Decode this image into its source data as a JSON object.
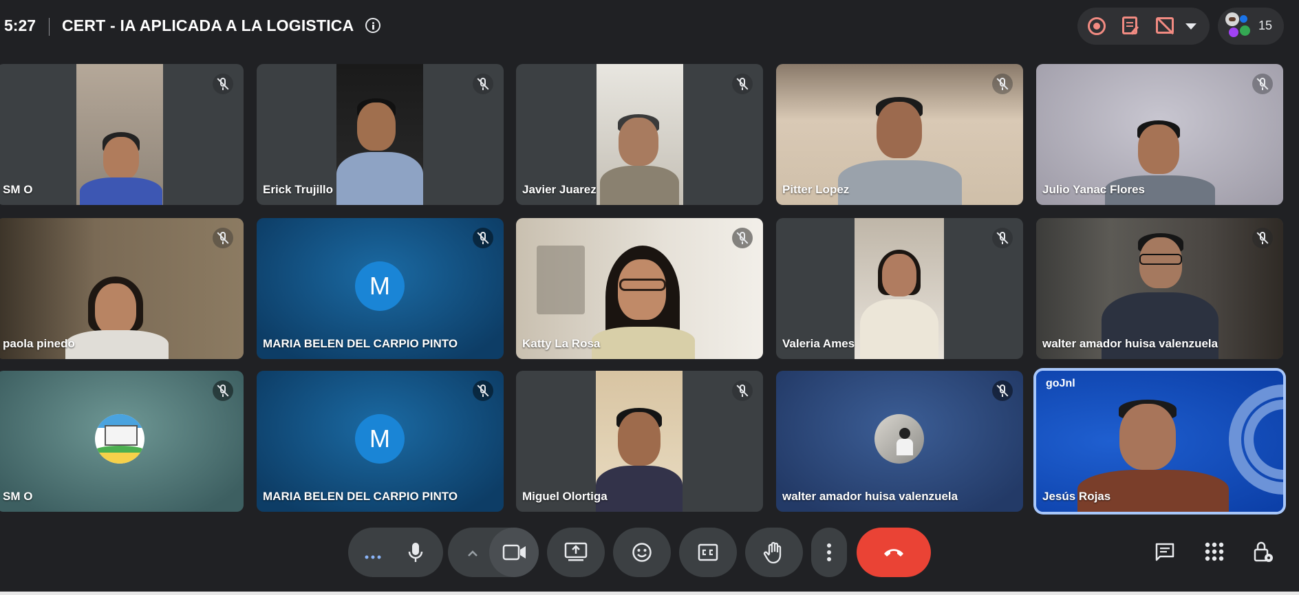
{
  "header": {
    "time": "5:27",
    "meeting_title": "CERT - IA APLICADA A LA LOGISTICA",
    "people_count": "15"
  },
  "tiles": [
    {
      "name": "SM O"
    },
    {
      "name": "Erick Trujillo"
    },
    {
      "name": "Javier Juarez"
    },
    {
      "name": "Pitter Lopez"
    },
    {
      "name": "Julio Yanac Flores"
    },
    {
      "name": "paola pinedo"
    },
    {
      "name": "MARIA BELEN DEL CARPIO PINTO",
      "initial": "M"
    },
    {
      "name": "Katty La Rosa"
    },
    {
      "name": "Valeria Ames"
    },
    {
      "name": "walter amador huisa valenzuela"
    },
    {
      "name": "SM O"
    },
    {
      "name": "MARIA BELEN DEL CARPIO PINTO",
      "initial": "M"
    },
    {
      "name": "Miguel Olortiga"
    },
    {
      "name": "walter amador huisa valenzuela"
    },
    {
      "name": "Jesús Rojas",
      "brand_text": "goJnl"
    }
  ],
  "colors": {
    "background": "#202124",
    "end_call": "#ea4335",
    "recording": "#f28b82",
    "active_speaker_border": "#a8c7fa"
  }
}
